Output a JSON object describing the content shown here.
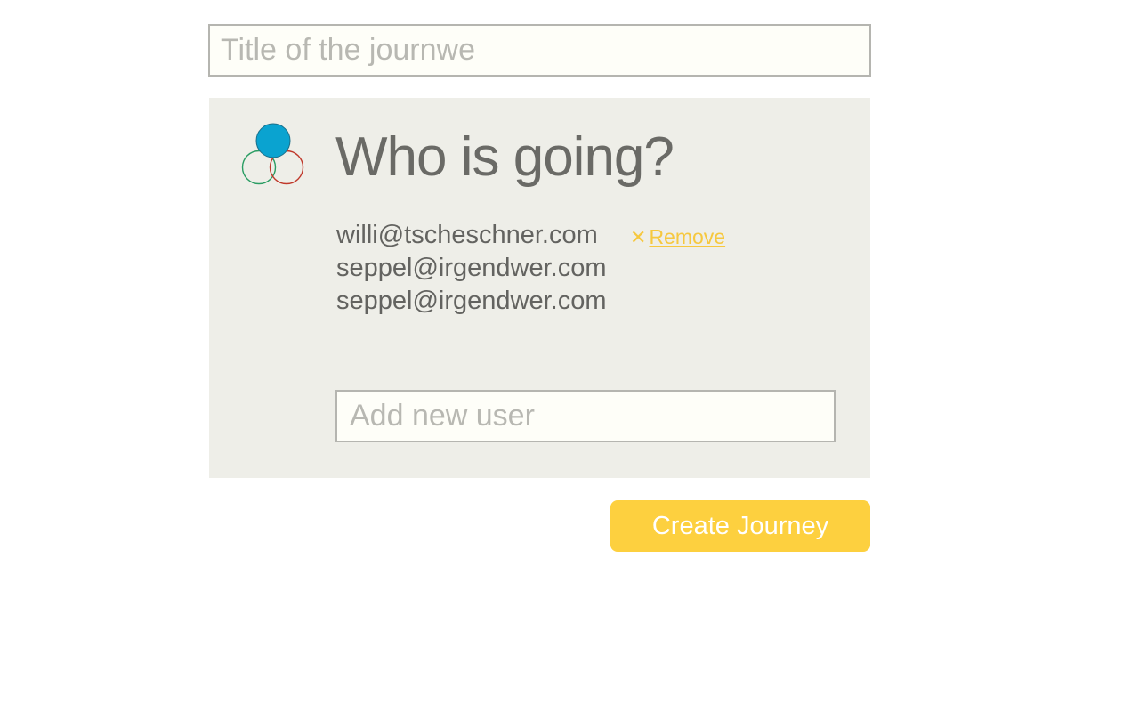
{
  "journey_title_input": {
    "placeholder": "Title of the journwe",
    "value": ""
  },
  "participants_panel": {
    "icon": "people-group-icon",
    "icon_colors": {
      "top": "#0aa3d0",
      "left": "#2a9d63",
      "right": "#c0392b"
    },
    "heading": "Who is going?",
    "members": [
      {
        "email": "willi@tscheschner.com",
        "remove_label": "Remove",
        "remove_icon": "x-icon"
      },
      {
        "email": "seppel@irgendwer.com"
      },
      {
        "email": "seppel@irgendwer.com"
      }
    ],
    "add_user_input": {
      "placeholder": "Add new user",
      "value": ""
    }
  },
  "create_button": {
    "label": "Create Journey",
    "color": "#fdd03f"
  },
  "accent_color": "#f6c83f"
}
